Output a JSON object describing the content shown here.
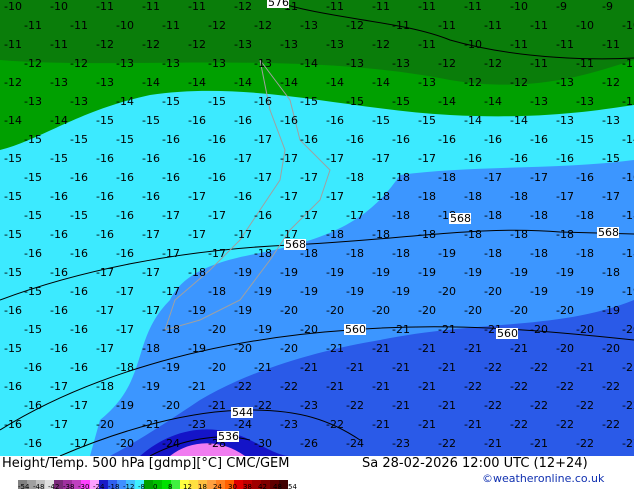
{
  "title": "Height/Temp. 500 hPa [gdmp][°C] CMC/GEM",
  "datetime": "Sa 28-02-2026 12:00 UTC (12+24)",
  "credit": "©weatheronline.co.uk",
  "colors": {
    "dark_green": "#0a7d0a",
    "green": "#00a000",
    "cyan": "#3ceaff",
    "blue": "#3c96ff",
    "deep_blue": "#2a5ae8",
    "navy": "#1414c8",
    "pink": "#f07cf0"
  },
  "scale": {
    "colors": [
      "#808080",
      "#a0a0a0",
      "#c0c0c0",
      "#e0e0e0",
      "#7a2a7a",
      "#a030a0",
      "#c040c0",
      "#ff40ff",
      "#ffa0ff",
      "#1a1ac8",
      "#3060f0",
      "#4090ff",
      "#40c0ff",
      "#40f0ff",
      "#00a000",
      "#00c000",
      "#00e000",
      "#40f040",
      "#ffff40",
      "#ffe040",
      "#ffc040",
      "#ffa040",
      "#ff8020",
      "#ff6000",
      "#e00000",
      "#c00000",
      "#a00000",
      "#800000",
      "#600000",
      "#400000"
    ],
    "labels": [
      "-54",
      "-48",
      "-42",
      "-38",
      "-30",
      "-24",
      "-18",
      "-12",
      "-8",
      "0",
      "8",
      "12",
      "18",
      "24",
      "30",
      "38",
      "42",
      "48",
      "54"
    ]
  },
  "contour_labels": [
    "576",
    "568",
    "568",
    "568",
    "560",
    "560",
    "544",
    "536"
  ],
  "temperature_rows": [
    [
      "-10",
      "-10",
      "-11",
      "-11",
      "-11",
      "-12",
      "-11",
      "-11",
      "-11",
      "-11",
      "-11",
      "-10",
      "-9",
      "-9"
    ],
    [
      "-11",
      "-11",
      "-10",
      "-11",
      "-12",
      "-12",
      "-13",
      "-12",
      "-11",
      "-11",
      "-11",
      "-11",
      "-10",
      "-10"
    ],
    [
      "-11",
      "-11",
      "-12",
      "-12",
      "-12",
      "-13",
      "-13",
      "-13",
      "-12",
      "-11",
      "-10",
      "-11",
      "-11",
      "-11"
    ],
    [
      "-12",
      "-12",
      "-13",
      "-13",
      "-13",
      "-13",
      "-14",
      "-13",
      "-13",
      "-12",
      "-12",
      "-11",
      "-11",
      "-11"
    ],
    [
      "-12",
      "-13",
      "-13",
      "-14",
      "-14",
      "-14",
      "-14",
      "-14",
      "-14",
      "-13",
      "-12",
      "-12",
      "-13",
      "-12"
    ],
    [
      "-13",
      "-13",
      "-14",
      "-15",
      "-15",
      "-16",
      "-15",
      "-15",
      "-15",
      "-14",
      "-14",
      "-13",
      "-13",
      "-13"
    ],
    [
      "-14",
      "-14",
      "-15",
      "-15",
      "-16",
      "-16",
      "-16",
      "-16",
      "-15",
      "-15",
      "-14",
      "-14",
      "-13",
      "-13"
    ],
    [
      "-15",
      "-15",
      "-15",
      "-16",
      "-16",
      "-17",
      "-16",
      "-16",
      "-16",
      "-16",
      "-16",
      "-16",
      "-15",
      "-14"
    ],
    [
      "-15",
      "-15",
      "-16",
      "-16",
      "-16",
      "-17",
      "-17",
      "-17",
      "-17",
      "-17",
      "-16",
      "-16",
      "-16",
      "-15"
    ],
    [
      "-15",
      "-16",
      "-16",
      "-16",
      "-16",
      "-17",
      "-17",
      "-18",
      "-18",
      "-18",
      "-17",
      "-17",
      "-16",
      "-16"
    ],
    [
      "-15",
      "-16",
      "-16",
      "-16",
      "-17",
      "-16",
      "-17",
      "-17",
      "-18",
      "-18",
      "-18",
      "-18",
      "-17",
      "-17"
    ],
    [
      "-15",
      "-15",
      "-16",
      "-17",
      "-17",
      "-16",
      "-17",
      "-17",
      "-18",
      "-18",
      "-18",
      "-18",
      "-18",
      "-18"
    ],
    [
      "-15",
      "-16",
      "-16",
      "-17",
      "-17",
      "-17",
      "-17",
      "-18",
      "-18",
      "-18",
      "-18",
      "-18",
      "-18",
      "-18"
    ],
    [
      "-16",
      "-16",
      "-16",
      "-17",
      "-17",
      "-18",
      "-18",
      "-18",
      "-18",
      "-19",
      "-18",
      "-18",
      "-18",
      "-18"
    ],
    [
      "-15",
      "-16",
      "-17",
      "-17",
      "-18",
      "-19",
      "-19",
      "-19",
      "-19",
      "-19",
      "-19",
      "-19",
      "-19",
      "-18"
    ],
    [
      "-15",
      "-16",
      "-17",
      "-17",
      "-18",
      "-19",
      "-19",
      "-19",
      "-19",
      "-20",
      "-20",
      "-19",
      "-19",
      "-19"
    ],
    [
      "-16",
      "-16",
      "-17",
      "-17",
      "-19",
      "-19",
      "-20",
      "-20",
      "-20",
      "-20",
      "-20",
      "-20",
      "-20",
      "-19"
    ],
    [
      "-15",
      "-16",
      "-17",
      "-18",
      "-20",
      "-19",
      "-20",
      "-20",
      "-21",
      "-21",
      "-21",
      "-20",
      "-20",
      "-20"
    ],
    [
      "-15",
      "-16",
      "-17",
      "-18",
      "-19",
      "-20",
      "-20",
      "-21",
      "-21",
      "-21",
      "-21",
      "-21",
      "-20",
      "-20"
    ],
    [
      "-16",
      "-16",
      "-18",
      "-19",
      "-20",
      "-21",
      "-21",
      "-21",
      "-21",
      "-21",
      "-22",
      "-22",
      "-21",
      "-21"
    ],
    [
      "-16",
      "-17",
      "-18",
      "-19",
      "-21",
      "-22",
      "-22",
      "-21",
      "-21",
      "-21",
      "-22",
      "-22",
      "-22",
      "-22"
    ],
    [
      "-16",
      "-17",
      "-19",
      "-20",
      "-21",
      "-22",
      "-23",
      "-22",
      "-21",
      "-21",
      "-22",
      "-22",
      "-22",
      "-22"
    ],
    [
      "-16",
      "-17",
      "-20",
      "-21",
      "-23",
      "-24",
      "-23",
      "-22",
      "-21",
      "-21",
      "-21",
      "-22",
      "-22",
      "-22"
    ],
    [
      "-16",
      "-17",
      "-20",
      "-24",
      "-28",
      "-30",
      "-26",
      "-24",
      "-23",
      "-22",
      "-21",
      "-21",
      "-22",
      "-27"
    ]
  ]
}
